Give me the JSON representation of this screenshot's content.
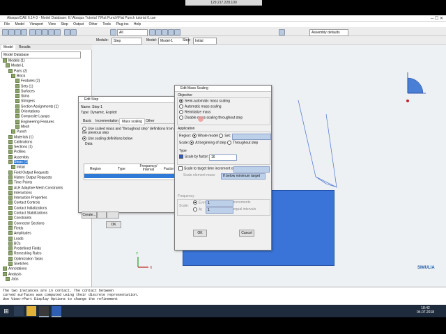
{
  "remote_title": "129.217.228.100",
  "window_title": "Abaqus/CAE 6.14-3 - Model Database: E:\\Abaqus Tutorial 7\\Flat Punch\\Flat Punch tutorial 0.cae",
  "menu": [
    "File",
    "Model",
    "Viewport",
    "View",
    "Step",
    "Output",
    "Other",
    "Tools",
    "Plug-ins",
    "Help"
  ],
  "toolbar": {
    "select_all": "All",
    "assembly_defaults": "Assembly defaults"
  },
  "context": {
    "module_label": "Module:",
    "module": "Step",
    "model_label": "Model:",
    "model": "Model-1",
    "step_label": "Step:",
    "step": "Initial"
  },
  "left_tabs": [
    "Model",
    "Results"
  ],
  "tree_header": "Model Database",
  "tree": [
    "Models (1)",
    "Model-1",
    "Parts (2)",
    "Block",
    "Features (2)",
    "Sets (1)",
    "Surfaces",
    "Skins",
    "Stringers",
    "Section Assignments (1)",
    "Orientations",
    "Composite Layups",
    "Engineering Features",
    "Mesh",
    "Punch",
    "Materials (1)",
    "Calibrations",
    "Sections (1)",
    "Profiles",
    "Assembly",
    "Steps (1)",
    "Initial",
    "Field Output Requests",
    "History Output Requests",
    "Time Points",
    "ALE Adaptive Mesh Constraints",
    "Interactions",
    "Interaction Properties",
    "Contact Controls",
    "Contact Initializations",
    "Contact Stabilizations",
    "Constraints",
    "Connector Sections",
    "Fields",
    "Amplitudes",
    "Loads",
    "BCs",
    "Predefined Fields",
    "Remeshing Rules",
    "Optimization Tasks",
    "Sketches",
    "Annotations",
    "Analysis",
    "Jobs"
  ],
  "messages": [
    "The two instances are in contact. The contact between",
    "curved surfaces was computed using their discrete representation.",
    "Use View->Part Display Options to change the refinement"
  ],
  "edit_step": {
    "title": "Edit Step",
    "name_label": "Name:",
    "name": "Step-1",
    "type_label": "Type:",
    "type": "Dynamic, Explicit",
    "tabs": [
      "Basic",
      "Incrementation",
      "Mass scaling",
      "Other"
    ],
    "opt1": "Use scaled mass and \"throughout step\" definitions from the previous step",
    "opt2": "Use scaling definitions below",
    "data_label": "Data",
    "columns": [
      "Region",
      "Type",
      "Frequency/ Interval",
      "Factor"
    ],
    "create": "Create...",
    "ok": "OK"
  },
  "mass_scaling": {
    "title": "Edit Mass Scaling",
    "objective_label": "Objective",
    "objectives": [
      "Semi-automatic mass scaling",
      "Automatic mass scaling",
      "Reinitialize mass",
      "Disable mass scaling throughout step"
    ],
    "application_label": "Application",
    "region_label": "Region:",
    "whole_model": "Whole model",
    "set": "Set:",
    "scale_label": "Scale:",
    "at_beginning": "At beginning of step",
    "throughout": "Throughout step",
    "type_label": "Type",
    "scale_by_factor": "Scale by factor:",
    "factor_value": "16",
    "scale_target": "Scale to target time increment of:",
    "element_mass_label": "Scale element mass:",
    "element_mass_value": "If below minimum target",
    "frequency_label": "Frequency",
    "every": "Every",
    "every_value": "1",
    "increments": "increments",
    "at": "At",
    "at_value": "1",
    "equal_intervals": "equal intervals",
    "ok": "OK",
    "cancel": "Cancel"
  },
  "viewport": {
    "brand": "SIMULIA"
  },
  "taskbar": {
    "time": "18:42",
    "date": "04.07.2018"
  }
}
